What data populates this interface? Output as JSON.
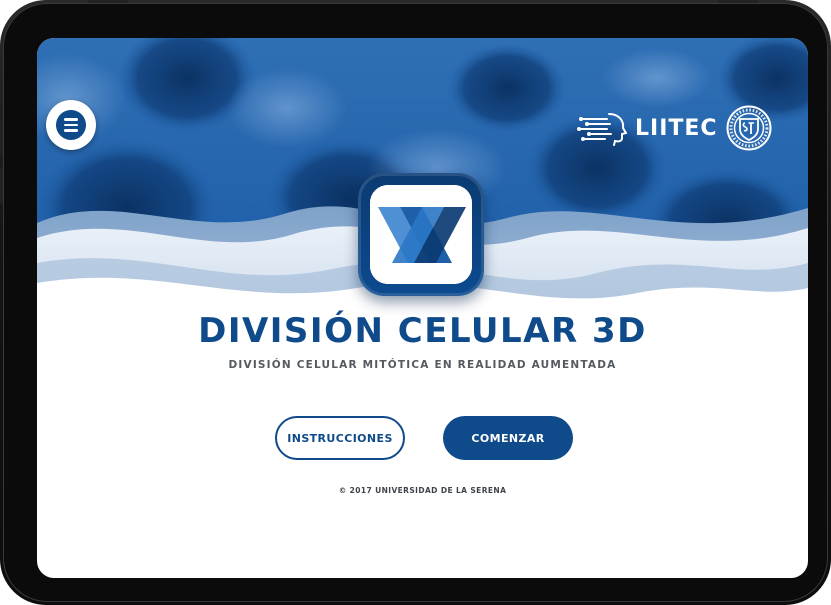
{
  "app": {
    "title": "DIVISIÓN CELULAR 3D",
    "subtitle": "DIVISIÓN CELULAR MITÓTICA EN REALIDAD AUMENTADA",
    "copyright": "© 2017 UNIVERSIDAD DE LA SERENA"
  },
  "header": {
    "menu_icon": "hamburger-menu-icon",
    "lab_logo_text": "LIITEC",
    "lab_logo_icon": "circuit-head-icon",
    "university_seal_icon": "university-seal-icon"
  },
  "buttons": {
    "instructions_label": "INSTRUCCIONES",
    "start_label": "COMENZAR"
  },
  "colors": {
    "primary": "#0f4a8a",
    "hero_blue": "#1d5fa8",
    "text_gray": "#555a60",
    "white": "#ffffff"
  }
}
